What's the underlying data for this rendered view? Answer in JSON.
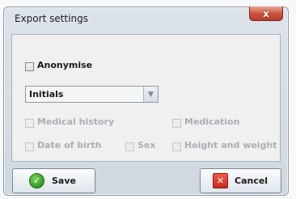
{
  "window": {
    "title": "Export settings",
    "close_label": "x"
  },
  "options": {
    "anonymise": {
      "label": "Anonymise",
      "checked": false,
      "enabled": true
    },
    "name_format": {
      "value": "Initials"
    },
    "medical_history": {
      "label": "Medical history",
      "checked": false,
      "enabled": false
    },
    "medication": {
      "label": "Medication",
      "checked": false,
      "enabled": false
    },
    "date_of_birth": {
      "label": "Date of birth",
      "checked": false,
      "enabled": false
    },
    "sex": {
      "label": "Sex",
      "checked": false,
      "enabled": false
    },
    "height_and_weight": {
      "label": "Height and weight",
      "checked": false,
      "enabled": false
    }
  },
  "buttons": {
    "save": {
      "label": "Save",
      "icon": "checkmark-icon"
    },
    "cancel": {
      "label": "Cancel",
      "icon": "cancel-icon"
    }
  },
  "colors": {
    "close_button": "#c9513c",
    "ok_icon": "#2e9b23",
    "cancel_icon": "#c72a1f",
    "disabled_text": "#a9b0b7"
  }
}
